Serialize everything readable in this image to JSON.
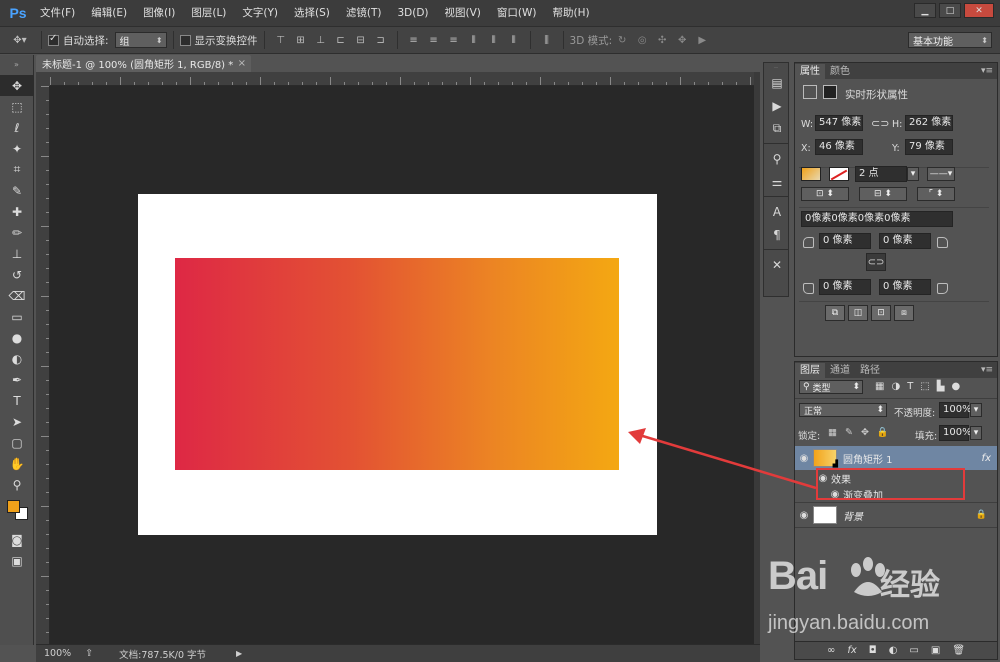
{
  "app": {
    "logo": "Ps"
  },
  "menu": [
    "文件(F)",
    "编辑(E)",
    "图像(I)",
    "图层(L)",
    "文字(Y)",
    "选择(S)",
    "滤镜(T)",
    "3D(D)",
    "视图(V)",
    "窗口(W)",
    "帮助(H)"
  ],
  "window_controls": {
    "minimize": "▁",
    "maximize": "□",
    "close": "✕"
  },
  "options": {
    "auto_select_label": "自动选择:",
    "auto_select_value": "组",
    "show_transform_label": "显示变换控件",
    "mode_3d_label": "3D 模式:",
    "workspace": "基本功能"
  },
  "document": {
    "tab_title": "未标题-1 @ 100% (圆角矩形 1, RGB/8) *",
    "tab_close": "×"
  },
  "status": {
    "zoom": "100%",
    "doc_info": "文档:787.5K/0 字节"
  },
  "properties": {
    "tabs": [
      "属性",
      "颜色"
    ],
    "heading": "实时形状属性",
    "w_label": "W:",
    "w_value": "547 像素",
    "h_label": "H:",
    "h_value": "262 像素",
    "x_label": "X:",
    "x_value": "46 像素",
    "y_label": "Y:",
    "y_value": "79 像素",
    "stroke_width": "2 点",
    "corner_summary": "0像素0像素0像素0像素",
    "corner_tl": "0 像素",
    "corner_tr": "0 像素",
    "corner_bl": "0 像素",
    "corner_br": "0 像素"
  },
  "layers": {
    "tabs": [
      "图层",
      "通道",
      "路径"
    ],
    "filter_kind": "类型",
    "blend_mode": "正常",
    "opacity_label": "不透明度:",
    "opacity_value": "100%",
    "lock_label": "锁定:",
    "fill_label": "填充:",
    "fill_value": "100%",
    "items": [
      {
        "name": "圆角矩形 1",
        "fx": "fx"
      },
      {
        "name": "效果"
      },
      {
        "name": "渐变叠加"
      },
      {
        "name": "背景"
      }
    ],
    "bottom_icons": [
      "∞",
      "fx",
      "◘",
      "◐",
      "▭",
      "▣",
      "🗑"
    ]
  },
  "shape": {
    "gradient_start": "#de2845",
    "gradient_end": "#f4a812"
  },
  "watermark": {
    "logo": "Bai",
    "logo_suffix": "经验",
    "url": "jingyan.baidu.com"
  },
  "colors": {
    "annotation": "#e23b3b"
  }
}
